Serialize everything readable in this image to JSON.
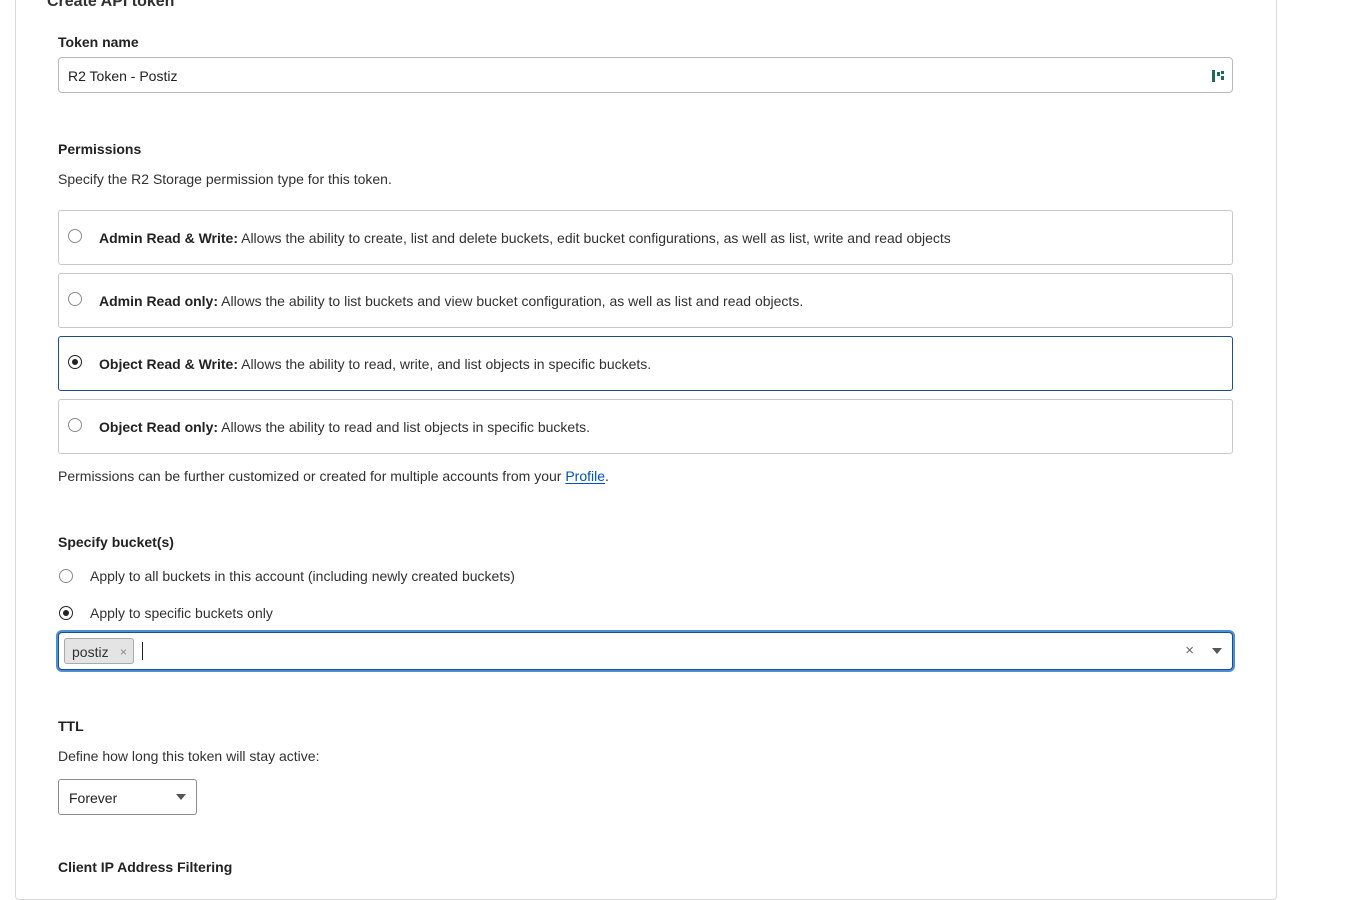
{
  "card_title": "Create API token",
  "token_name": {
    "label": "Token name",
    "value": "R2 Token - Postiz"
  },
  "permissions": {
    "title": "Permissions",
    "description": "Specify the R2 Storage permission type for this token.",
    "options": [
      {
        "label": "Admin Read & Write:",
        "text": " Allows the ability to create, list and delete buckets, edit bucket configurations, as well as list, write and read objects",
        "selected": false
      },
      {
        "label": "Admin Read only:",
        "text": " Allows the ability to list buckets and view bucket configuration, as well as list and read objects.",
        "selected": false
      },
      {
        "label": "Object Read & Write:",
        "text": " Allows the ability to read, write, and list objects in specific buckets.",
        "selected": true
      },
      {
        "label": "Object Read only:",
        "text": " Allows the ability to read and list objects in specific buckets.",
        "selected": false
      }
    ],
    "footer_prefix": "Permissions can be further customized or created for multiple accounts from your ",
    "footer_link": "Profile",
    "footer_suffix": "."
  },
  "buckets": {
    "title": "Specify bucket(s)",
    "option_all": "Apply to all buckets in this account (including newly created buckets)",
    "option_specific": "Apply to specific buckets only",
    "selected_chips": [
      "postiz"
    ],
    "chip_remove": "×",
    "clear": "×"
  },
  "ttl": {
    "title": "TTL",
    "description": "Define how long this token will stay active:",
    "value": "Forever"
  },
  "client_ip": {
    "title": "Client IP Address Filtering"
  },
  "colors": {
    "selected_border": "#1c4f8a",
    "focus_ring": "#4d8fd6",
    "link": "#0051c3"
  }
}
